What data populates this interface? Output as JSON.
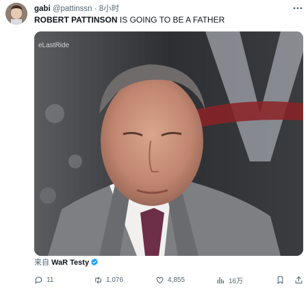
{
  "tweet": {
    "display_name": "gabi",
    "handle": "@pattinssn",
    "separator": "·",
    "time": "8小时",
    "text_bold": "ROBERT PATTINSON",
    "text_rest": " IS GOING TO BE A FATHER",
    "media_watermark": "eLastRide",
    "source_prefix": "来自 ",
    "source_name": "WaR Testy",
    "source_verified": true
  },
  "actions": {
    "replies": "11",
    "retweets": "1,076",
    "likes": "4,855",
    "views": "16万"
  },
  "colors": {
    "text_primary": "#0f1419",
    "text_secondary": "#536471",
    "verified_blue": "#1d9bf0"
  },
  "icons": [
    "more-icon",
    "reply-icon",
    "retweet-icon",
    "like-icon",
    "views-icon",
    "bookmark-icon",
    "share-icon",
    "verified-badge-icon"
  ]
}
